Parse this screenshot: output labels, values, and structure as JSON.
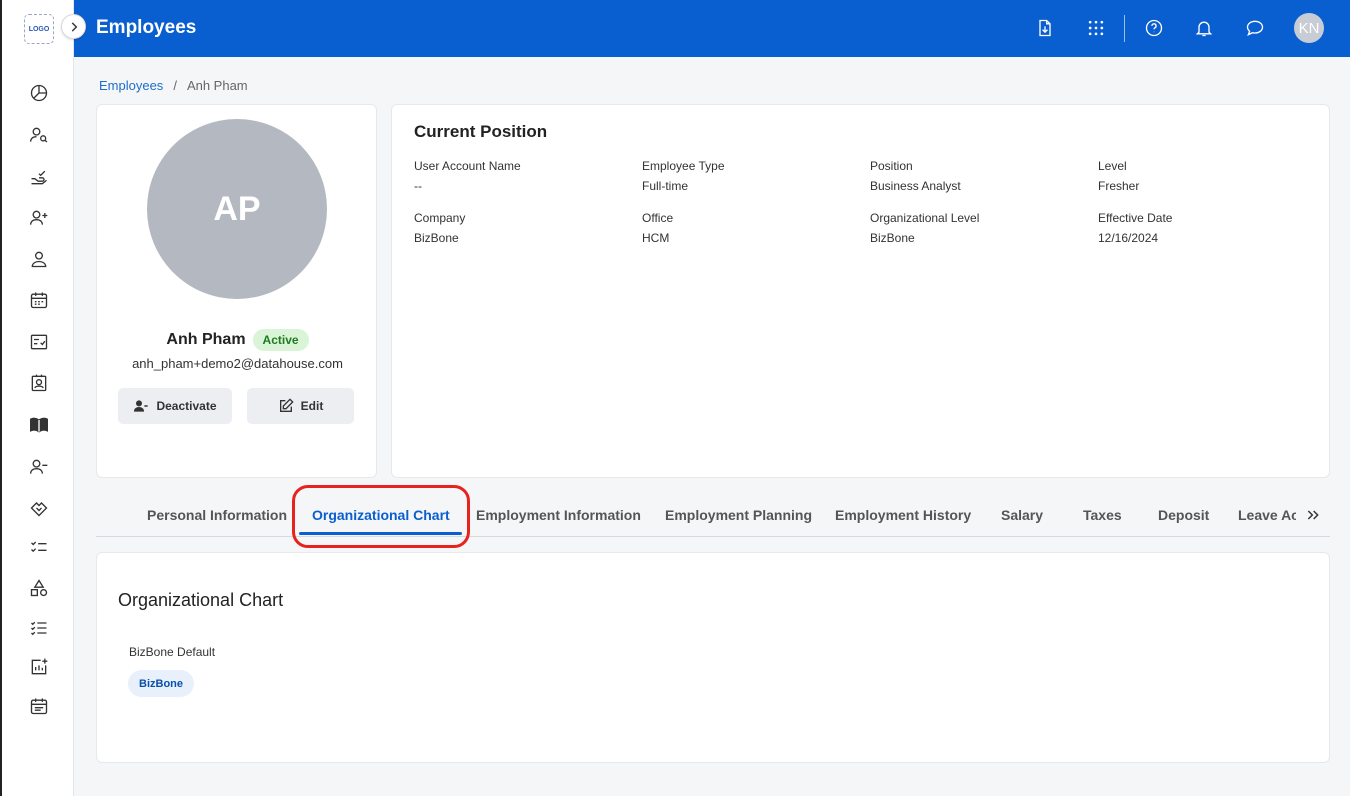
{
  "app": {
    "logo_text": "LOGO",
    "header_title": "Employees",
    "user_initials": "KN"
  },
  "breadcrumb": {
    "parent": "Employees",
    "separator": "/",
    "current": "Anh Pham"
  },
  "profile": {
    "initials": "AP",
    "name": "Anh Pham",
    "status": "Active",
    "email": "anh_pham+demo2@datahouse.com",
    "deactivate_label": "Deactivate",
    "edit_label": "Edit"
  },
  "current_position": {
    "title": "Current Position",
    "fields": [
      {
        "label": "User Account Name",
        "value": "--"
      },
      {
        "label": "Employee Type",
        "value": "Full-time"
      },
      {
        "label": "Position",
        "value": "Business Analyst"
      },
      {
        "label": "Level",
        "value": "Fresher"
      },
      {
        "label": "Company",
        "value": "BizBone"
      },
      {
        "label": "Office",
        "value": "HCM"
      },
      {
        "label": "Organizational Level",
        "value": "BizBone"
      },
      {
        "label": "Effective Date",
        "value": "12/16/2024"
      }
    ]
  },
  "tabs": [
    {
      "label": "Personal Information",
      "active": false
    },
    {
      "label": "Organizational Chart",
      "active": true
    },
    {
      "label": "Employment Information",
      "active": false
    },
    {
      "label": "Employment Planning",
      "active": false
    },
    {
      "label": "Employment History",
      "active": false
    },
    {
      "label": "Salary",
      "active": false
    },
    {
      "label": "Taxes",
      "active": false
    },
    {
      "label": "Deposit",
      "active": false
    },
    {
      "label": "Leave Ac",
      "active": false
    }
  ],
  "org_chart": {
    "title": "Organizational Chart",
    "group_label": "BizBone Default",
    "chip": "BizBone"
  },
  "colors": {
    "header_bg": "#0a5fd0",
    "active_tab": "#0a5fd0",
    "status_bg": "#d9f4d7",
    "highlight": "#e8231e"
  },
  "sidebar_icons": [
    "dashboard-icon",
    "user-search-icon",
    "hand-check-icon",
    "user-add-icon",
    "user-icon",
    "calendar-icon",
    "checklist-card-icon",
    "id-card-icon",
    "book-icon",
    "user-remove-icon",
    "handshake-icon",
    "task-list-icon",
    "shapes-icon",
    "list-check-icon",
    "chart-add-icon",
    "calendar-list-icon"
  ]
}
